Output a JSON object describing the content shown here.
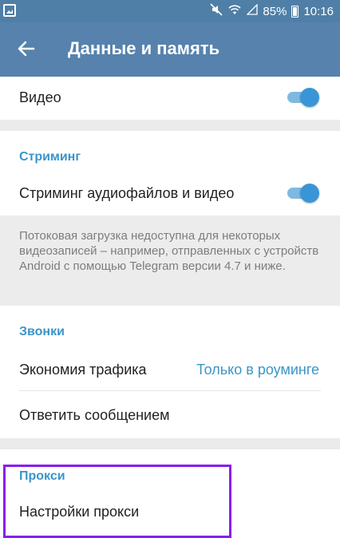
{
  "status_bar": {
    "battery": "85%",
    "time": "10:16",
    "icons": [
      "notification-image-icon",
      "mute-icon",
      "wifi-icon",
      "signal-icon",
      "battery-icon"
    ]
  },
  "app_bar": {
    "title": "Данные и память",
    "back_icon": "arrow-left-icon"
  },
  "video_row": {
    "label": "Видео",
    "toggle_on": true
  },
  "streaming": {
    "header": "Стриминг",
    "row_label": "Стриминг аудиофайлов и видео",
    "toggle_on": true,
    "info": "Потоковая загрузка недоступна для некоторых видеозаписей – например, отправленных с устройств Android с помощью Telegram версии 4.7 и ниже."
  },
  "calls": {
    "header": "Звонки",
    "economy_label": "Экономия трафика",
    "economy_value": "Только в роуминге",
    "reply_label": "Ответить сообщением"
  },
  "proxy": {
    "header": "Прокси",
    "settings_label": "Настройки прокси"
  },
  "colors": {
    "status_bar": "#4f7fa6",
    "app_bar": "#5682ad",
    "accent": "#3a95c9",
    "highlight": "#8a1cf0"
  }
}
